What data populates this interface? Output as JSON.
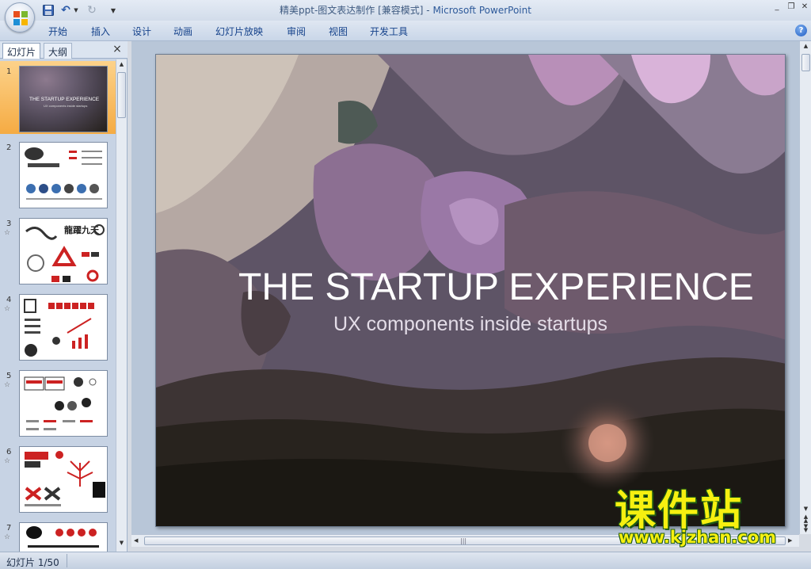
{
  "window": {
    "title_doc": "精美ppt-图文表达制作 [兼容模式] - ",
    "title_app": "Microsoft PowerPoint",
    "help_label": "?"
  },
  "ribbon": {
    "tabs": [
      "开始",
      "插入",
      "设计",
      "动画",
      "幻灯片放映",
      "审阅",
      "视图",
      "开发工具"
    ]
  },
  "pane": {
    "tab_slides": "幻灯片",
    "tab_outline": "大纲",
    "close_label": "×",
    "thumbnails": [
      {
        "number": "1",
        "selected": true,
        "has_animation": false,
        "title": "THE STARTUP EXPERIENCE",
        "subtitle": "UX components inside startups"
      },
      {
        "number": "2",
        "selected": false,
        "has_animation": false
      },
      {
        "number": "3",
        "selected": false,
        "has_animation": true
      },
      {
        "number": "4",
        "selected": false,
        "has_animation": true
      },
      {
        "number": "5",
        "selected": false,
        "has_animation": true
      },
      {
        "number": "6",
        "selected": false,
        "has_animation": true
      },
      {
        "number": "7",
        "selected": false,
        "has_animation": true
      }
    ],
    "animation_glyph": "☆",
    "thumb3_text": "龍躍九天"
  },
  "slide": {
    "title": "THE STARTUP EXPERIENCE",
    "subtitle": "UX components inside startups"
  },
  "status": {
    "slide_count": "幻灯片 1/50"
  },
  "watermark": {
    "text": "课件站",
    "url": "www.kjzhan.com"
  },
  "colors": {
    "selected_thumb": "#f5ab43",
    "ribbon_text": "#15428b",
    "watermark_fill": "#f6f010",
    "watermark_outline": "#1d5a14"
  }
}
